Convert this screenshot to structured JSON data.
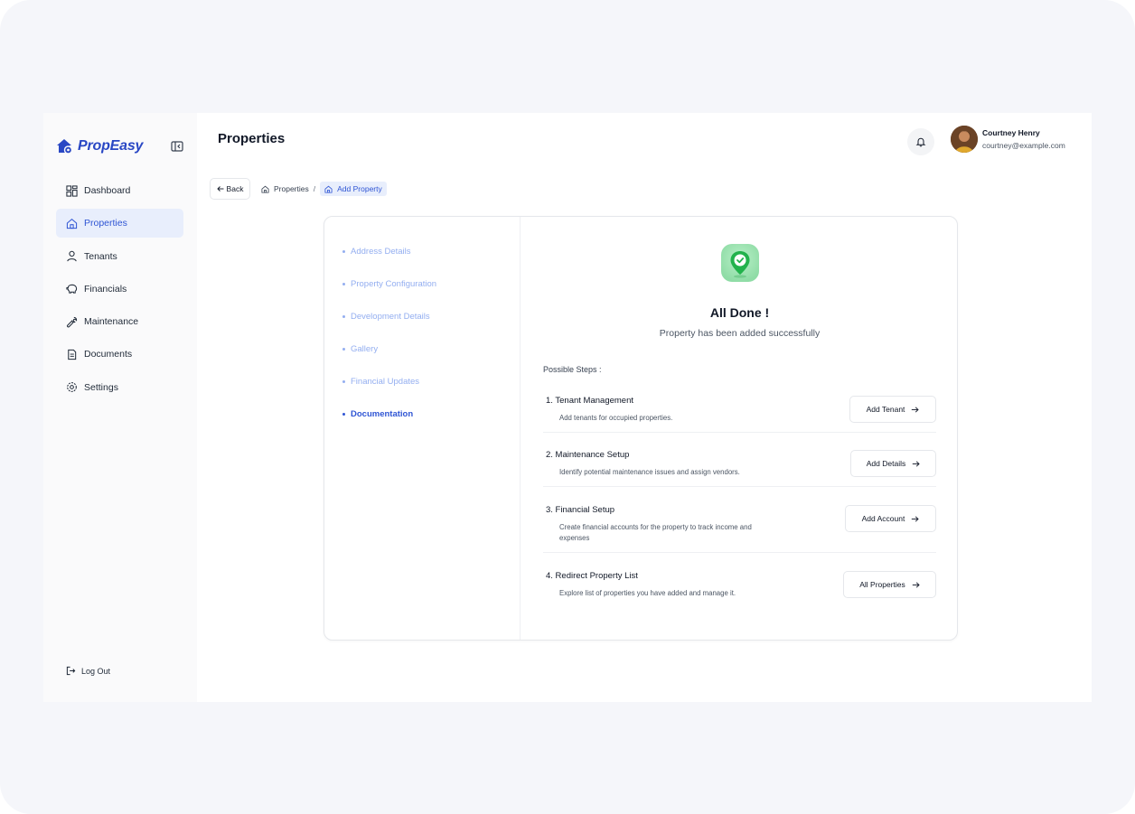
{
  "brand": {
    "name": "PropEasy",
    "color": "#2947c4"
  },
  "sidebar": {
    "items": [
      {
        "label": "Dashboard",
        "icon": "dashboard-icon"
      },
      {
        "label": "Properties",
        "icon": "home-icon",
        "active": true
      },
      {
        "label": "Tenants",
        "icon": "user-icon"
      },
      {
        "label": "Financials",
        "icon": "piggy-bank-icon"
      },
      {
        "label": "Maintenance",
        "icon": "wrench-icon"
      },
      {
        "label": "Documents",
        "icon": "document-icon"
      },
      {
        "label": "Settings",
        "icon": "gear-icon"
      }
    ],
    "logout_label": "Log Out"
  },
  "header": {
    "title": "Properties",
    "user": {
      "name": "Courtney Henry",
      "email": "courtney@example.com"
    }
  },
  "breadcrumb": {
    "back_label": "Back",
    "items": [
      "Properties",
      "Add Property"
    ]
  },
  "wizard": {
    "steps": [
      {
        "label": "Address Details"
      },
      {
        "label": "Property Configuration"
      },
      {
        "label": "Development Details"
      },
      {
        "label": "Gallery"
      },
      {
        "label": "Financial Updates"
      },
      {
        "label": "Documentation",
        "active": true
      }
    ]
  },
  "result": {
    "title": "All Done !",
    "subtitle": "Property has been added successfully",
    "possible_label": "Possible Steps :",
    "tasks": [
      {
        "title": "1. Tenant Management",
        "desc": "Add tenants for occupied properties.",
        "button": "Add Tenant"
      },
      {
        "title": "2. Maintenance Setup",
        "desc": "Identify potential maintenance issues and assign vendors.",
        "button": "Add Details"
      },
      {
        "title": "3. Financial Setup",
        "desc": "Create financial accounts for the property to track income and expenses",
        "button": "Add Account"
      },
      {
        "title": "4. Redirect Property List",
        "desc": "Explore list of properties you have added and manage it.",
        "button": "All Properties"
      }
    ]
  },
  "colors": {
    "accent": "#2f55d4",
    "accent_light": "#e8eefc",
    "step_inactive": "#93aef0",
    "success": "#22c55e"
  }
}
